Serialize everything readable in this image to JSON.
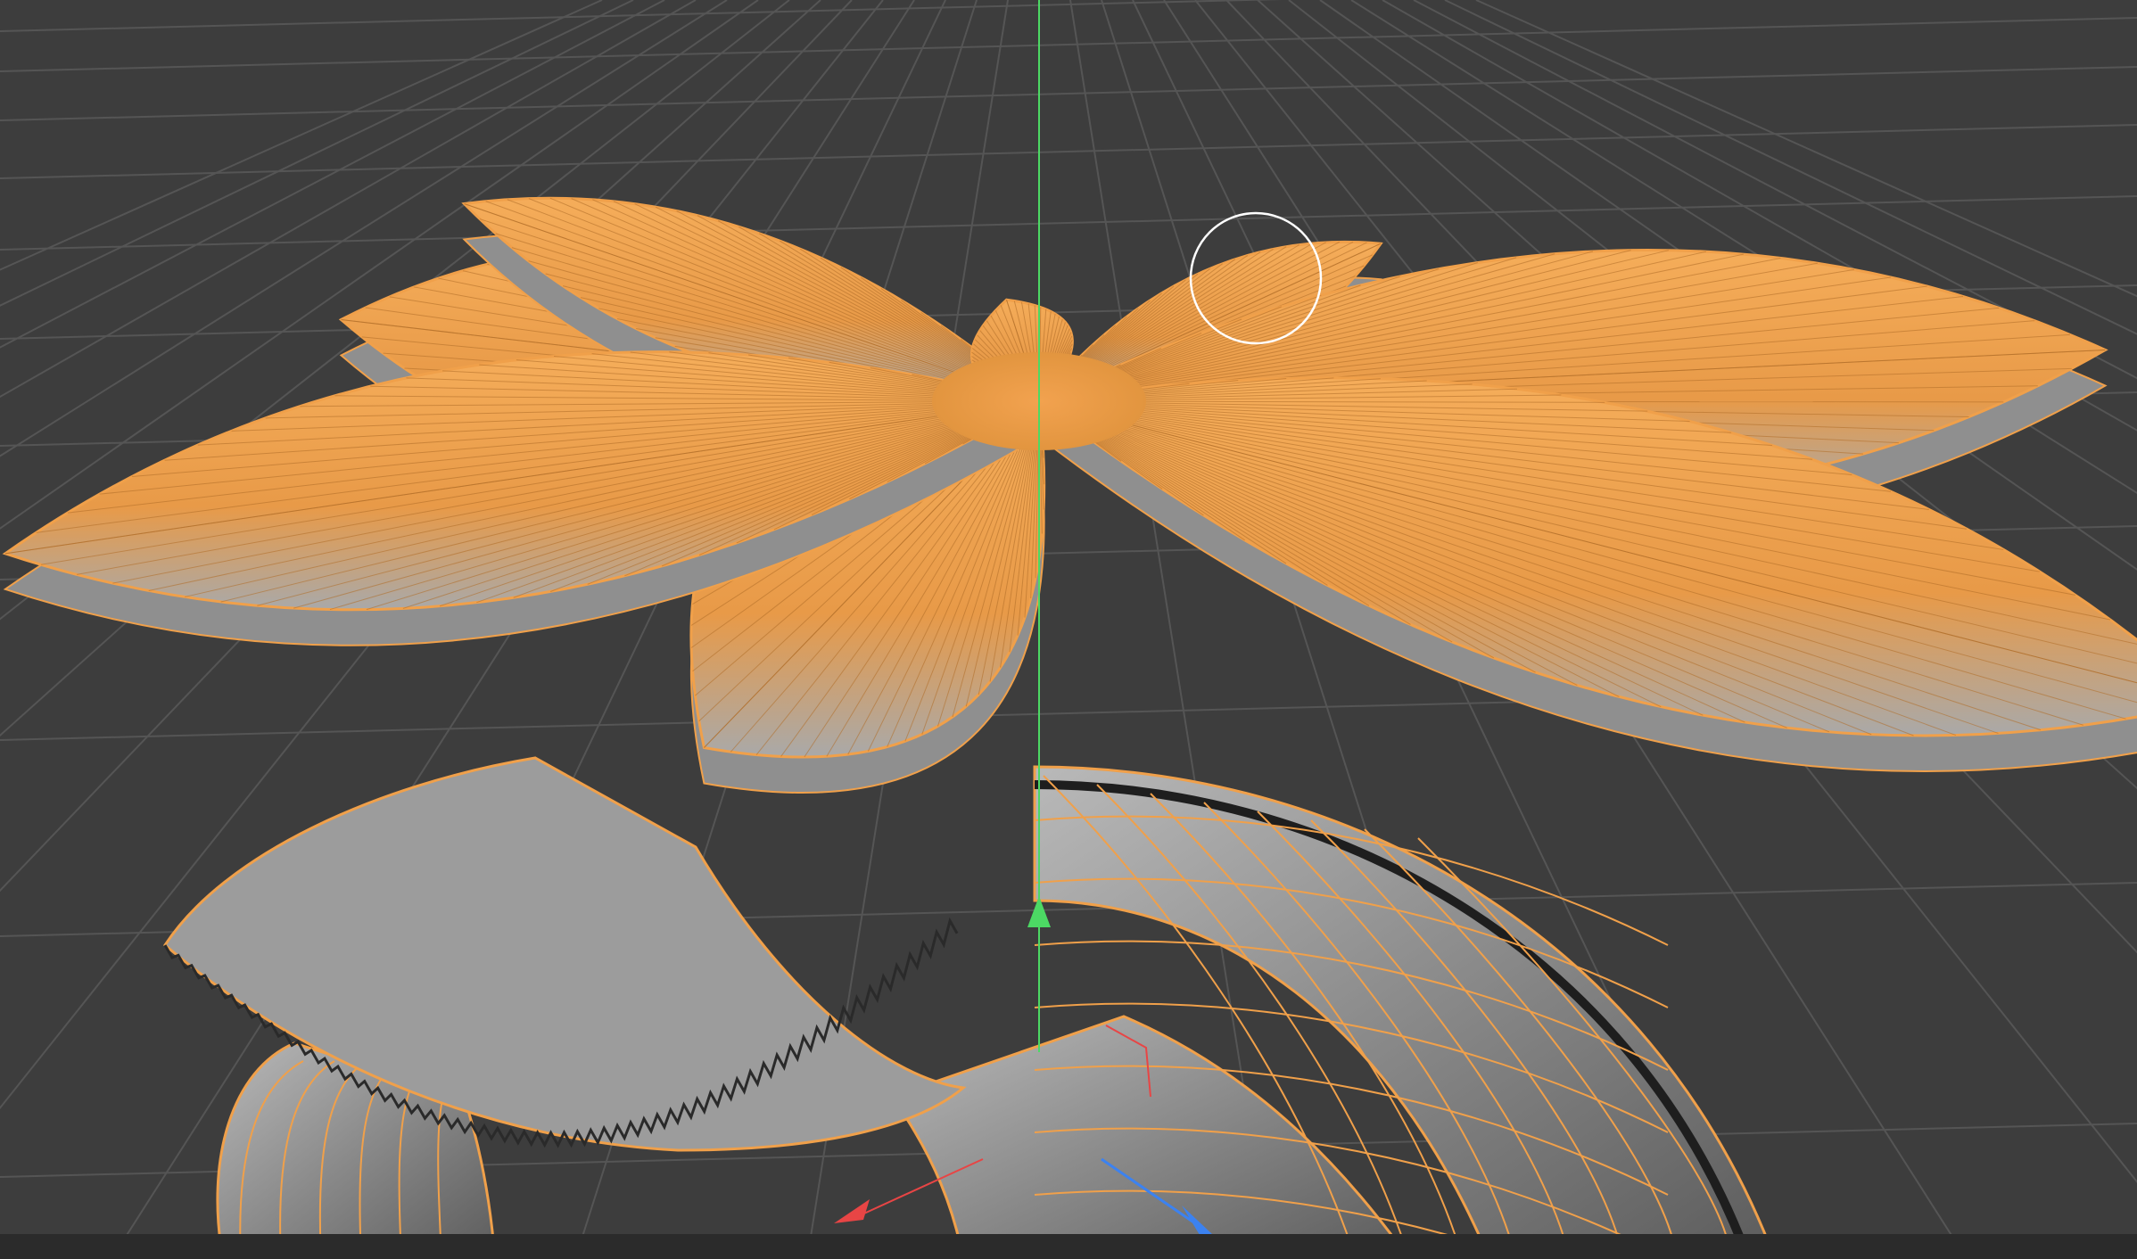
{
  "colors": {
    "background": "#3d3d3d",
    "grid": "#555555",
    "selection_orange": "#f0a04a",
    "mesh_gray": "#8e8e8e",
    "axis_y": "#4cd964",
    "axis_x": "#e84545",
    "axis_z": "#3c82f0",
    "status_bar": "#2b2b2b"
  },
  "viewport": {
    "objects": [
      {
        "name": "flower-mesh",
        "petals": 8,
        "selected": true
      },
      {
        "name": "ring-mesh",
        "selected": true
      }
    ],
    "icons": [
      "brush-cursor-icon",
      "axis-gizmo-icon"
    ]
  }
}
